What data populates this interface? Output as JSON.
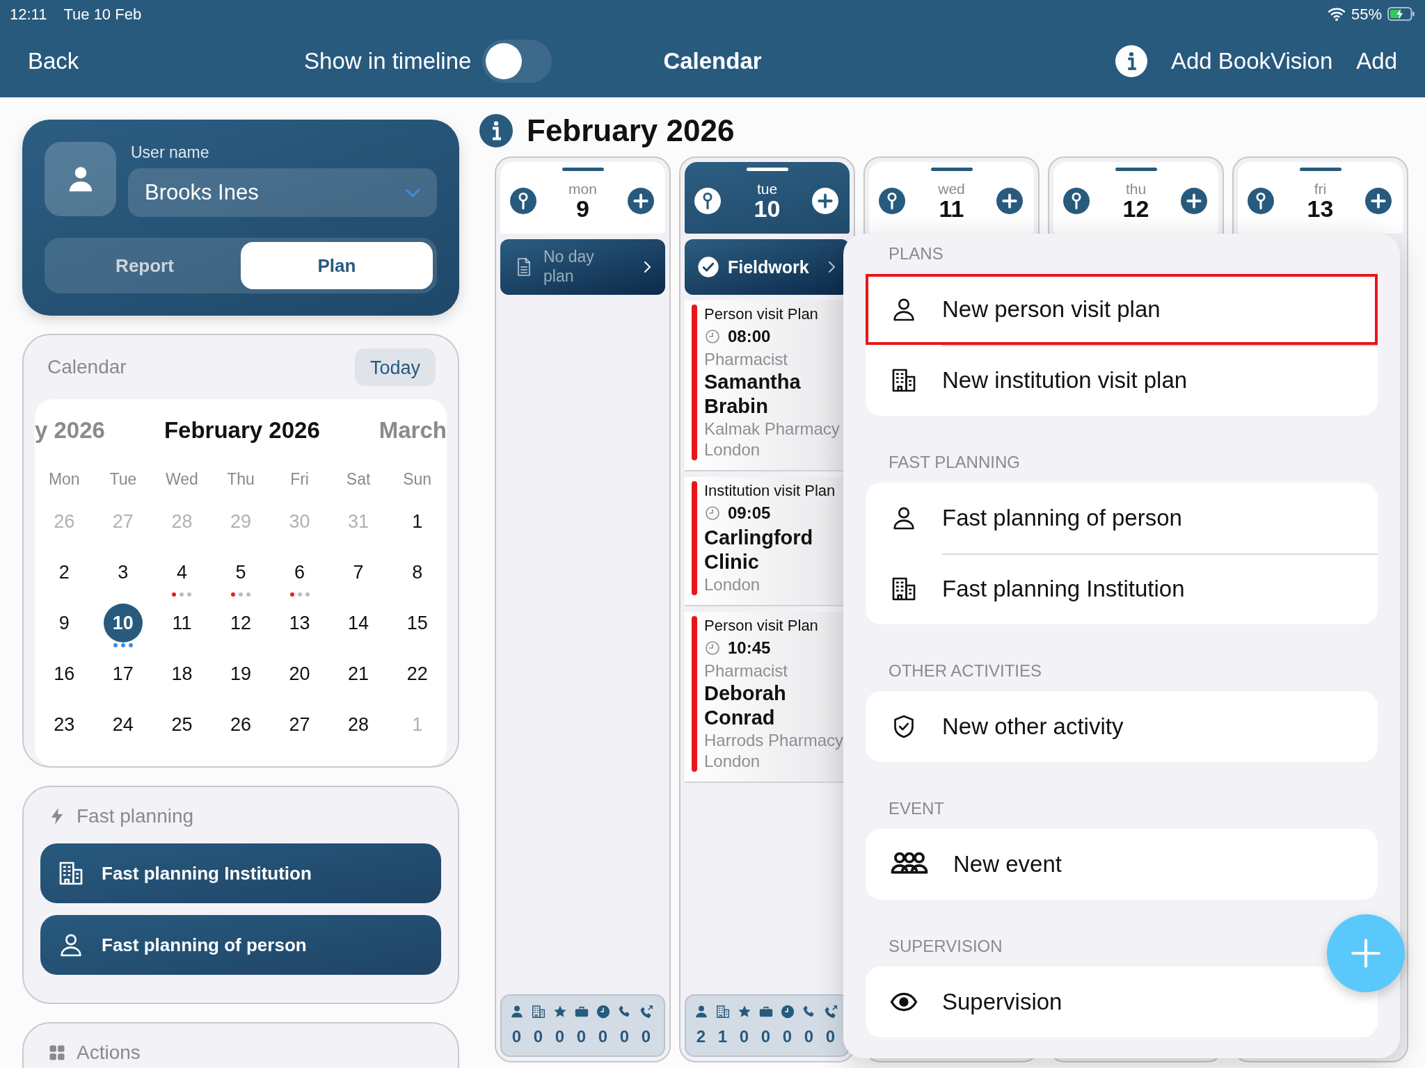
{
  "status_bar": {
    "time": "12:11",
    "date": "Tue 10 Feb",
    "battery": "55%"
  },
  "nav_bar": {
    "back": "Back",
    "toggle_label": "Show in timeline",
    "toggle_on": false,
    "title": "Calendar",
    "actions": [
      "Add BookVision",
      "Add"
    ]
  },
  "user_card": {
    "label": "User name",
    "user": "Brooks Ines",
    "segments": [
      {
        "label": "Report",
        "selected": false
      },
      {
        "label": "Plan",
        "selected": true
      }
    ]
  },
  "calendar": {
    "title": "Calendar",
    "today_button": "Today",
    "prev_month": "y 2026",
    "month": "February 2026",
    "next_month": "March",
    "weekdays": [
      "Mon",
      "Tue",
      "Wed",
      "Thu",
      "Fri",
      "Sat",
      "Sun"
    ],
    "weeks": [
      [
        {
          "day": "26",
          "outside": true,
          "selected": false
        },
        {
          "day": "27",
          "outside": true,
          "selected": false
        },
        {
          "day": "28",
          "outside": true,
          "selected": false
        },
        {
          "day": "29",
          "outside": true,
          "selected": false
        },
        {
          "day": "30",
          "outside": true,
          "selected": false
        },
        {
          "day": "31",
          "outside": true,
          "selected": false
        },
        {
          "day": "1",
          "outside": false,
          "selected": false
        }
      ],
      [
        {
          "day": "2",
          "outside": false,
          "selected": false
        },
        {
          "day": "3",
          "outside": false,
          "selected": false
        },
        {
          "day": "4",
          "outside": false,
          "selected": false,
          "dots": [
            {
              "color": "#ee1c1c"
            },
            {
              "color": "#b4bfcc"
            },
            {
              "color": "#b4bfcc"
            }
          ]
        },
        {
          "day": "5",
          "outside": false,
          "selected": false,
          "dots": [
            {
              "color": "#ee1c1c"
            },
            {
              "color": "#b4bfcc"
            },
            {
              "color": "#b4bfcc"
            }
          ]
        },
        {
          "day": "6",
          "outside": false,
          "selected": false,
          "dots": [
            {
              "color": "#ee1c1c"
            },
            {
              "color": "#b4bfcc"
            },
            {
              "color": "#b4bfcc"
            }
          ]
        },
        {
          "day": "7",
          "outside": false,
          "selected": false
        },
        {
          "day": "8",
          "outside": false,
          "selected": false
        }
      ],
      [
        {
          "day": "9",
          "outside": false,
          "selected": false
        },
        {
          "day": "10",
          "outside": false,
          "selected": true,
          "dots": [
            {
              "color": "#3a8ee6"
            },
            {
              "color": "#3a8ee6"
            },
            {
              "color": "#3a8ee6"
            }
          ]
        },
        {
          "day": "11",
          "outside": false,
          "selected": false
        },
        {
          "day": "12",
          "outside": false,
          "selected": false
        },
        {
          "day": "13",
          "outside": false,
          "selected": false
        },
        {
          "day": "14",
          "outside": false,
          "selected": false
        },
        {
          "day": "15",
          "outside": false,
          "selected": false
        }
      ],
      [
        {
          "day": "16",
          "outside": false,
          "selected": false
        },
        {
          "day": "17",
          "outside": false,
          "selected": false
        },
        {
          "day": "18",
          "outside": false,
          "selected": false
        },
        {
          "day": "19",
          "outside": false,
          "selected": false
        },
        {
          "day": "20",
          "outside": false,
          "selected": false
        },
        {
          "day": "21",
          "outside": false,
          "selected": false
        },
        {
          "day": "22",
          "outside": false,
          "selected": false
        }
      ],
      [
        {
          "day": "23",
          "outside": false,
          "selected": false
        },
        {
          "day": "24",
          "outside": false,
          "selected": false
        },
        {
          "day": "25",
          "outside": false,
          "selected": false
        },
        {
          "day": "26",
          "outside": false,
          "selected": false
        },
        {
          "day": "27",
          "outside": false,
          "selected": false
        },
        {
          "day": "28",
          "outside": false,
          "selected": false
        },
        {
          "day": "1",
          "outside": true,
          "selected": false
        }
      ]
    ]
  },
  "fast_planning": {
    "title": "Fast planning",
    "buttons": [
      {
        "label": "Fast planning Institution",
        "kind": "institution"
      },
      {
        "label": "Fast planning of person",
        "kind": "person"
      }
    ]
  },
  "actions": {
    "title": "Actions"
  },
  "month_title": "February 2026",
  "days": [
    {
      "weekday": "mon",
      "date": "9",
      "selected": false,
      "day_plan": {
        "label": "No day plan",
        "done": false
      },
      "stats": [
        "0",
        "0",
        "0",
        "0",
        "0",
        "0",
        "0"
      ]
    },
    {
      "weekday": "tue",
      "date": "10",
      "selected": true,
      "day_plan": {
        "label": "Fieldwork",
        "done": true
      },
      "entries": [
        {
          "type": "Person visit Plan",
          "time": "08:00",
          "role": "Pharmacist",
          "name": "Samantha Brabin",
          "place": "Kalmak Pharmacy",
          "city": "London"
        },
        {
          "type": "Institution visit Plan",
          "time": "09:05",
          "name": "Carlingford Clinic",
          "city": "London"
        },
        {
          "type": "Person visit Plan",
          "time": "10:45",
          "role": "Pharmacist",
          "name": "Deborah Conrad",
          "place": "Harrods Pharmacy",
          "city": "London"
        }
      ],
      "stats": [
        "2",
        "1",
        "0",
        "0",
        "0",
        "0",
        "0"
      ]
    },
    {
      "weekday": "wed",
      "date": "11",
      "selected": false
    },
    {
      "weekday": "thu",
      "date": "12",
      "selected": false
    },
    {
      "weekday": "fri",
      "date": "13",
      "selected": false
    }
  ],
  "menu": {
    "sections": [
      {
        "header": "PLANS",
        "items": [
          {
            "label": "New person visit plan",
            "kind": "person",
            "highlighted": true
          },
          {
            "label": "New institution visit plan",
            "kind": "institution",
            "highlighted": false
          }
        ]
      },
      {
        "header": "FAST PLANNING",
        "items": [
          {
            "label": "Fast planning of person",
            "kind": "person",
            "highlighted": false
          },
          {
            "label": "Fast planning Institution",
            "kind": "institution",
            "highlighted": false
          }
        ]
      },
      {
        "header": "OTHER ACTIVITIES",
        "items": [
          {
            "label": "New other activity",
            "kind": "activity",
            "highlighted": false
          }
        ]
      },
      {
        "header": "EVENT",
        "items": [
          {
            "label": "New event",
            "kind": "event",
            "highlighted": false
          }
        ]
      },
      {
        "header": "SUPERVISION",
        "items": [
          {
            "label": "Supervision",
            "kind": "supervision",
            "highlighted": false
          }
        ]
      }
    ]
  }
}
